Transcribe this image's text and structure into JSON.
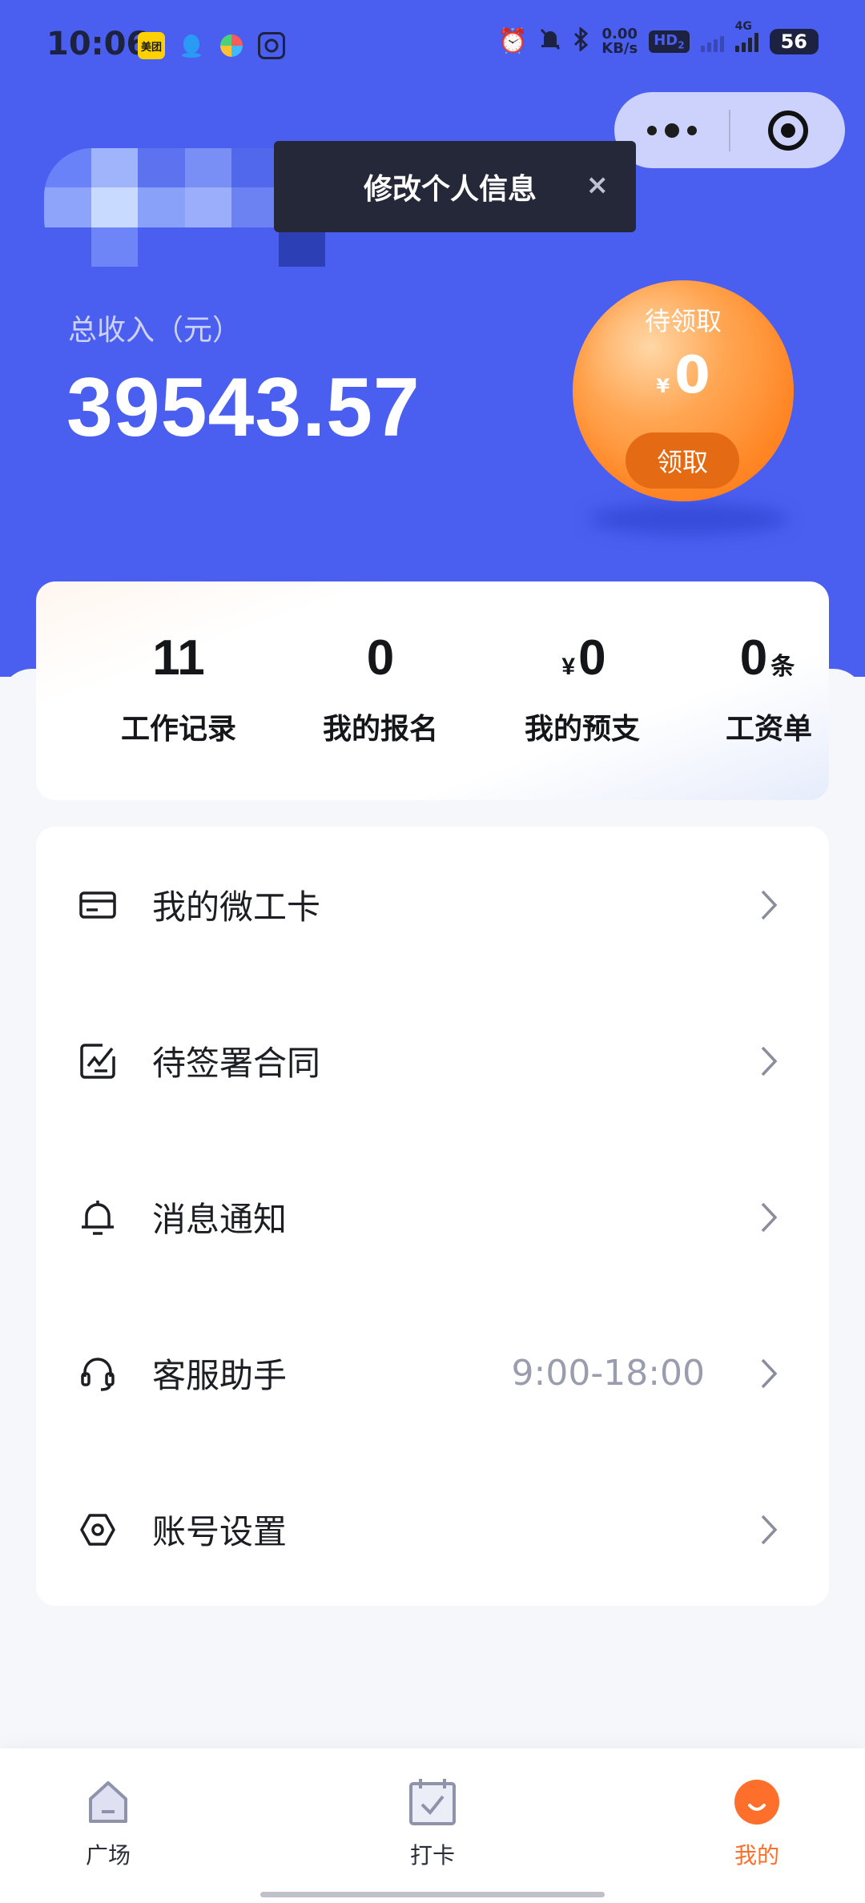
{
  "status_bar": {
    "time": "10:06",
    "app_icons": [
      "meituan-icon",
      "qq-icon",
      "pinwheel-icon",
      "camera-icon"
    ],
    "meituan_label": "美团",
    "speed_value": "0.00",
    "speed_unit": "KB/s",
    "hd_label": "HD",
    "hd_sub": "2",
    "network_label": "4G",
    "battery": "56"
  },
  "tooltip": {
    "text": "修改个人信息",
    "close": "×"
  },
  "income": {
    "label": "总收入（元）",
    "value": "39543.57"
  },
  "bubble": {
    "label": "待领取",
    "currency": "¥",
    "amount": "0",
    "button": "领取"
  },
  "stats": [
    {
      "value": "11",
      "label": "工作记录"
    },
    {
      "value": "0",
      "label": "我的报名"
    },
    {
      "prefix": "¥",
      "value": "0",
      "label": "我的预支"
    },
    {
      "value": "0",
      "suffix": "条",
      "label": "工资单"
    }
  ],
  "menu": [
    {
      "label": "我的微工卡",
      "icon": "card-icon"
    },
    {
      "label": "待签署合同",
      "icon": "contract-icon"
    },
    {
      "label": "消息通知",
      "icon": "bell-icon"
    },
    {
      "label": "客服助手",
      "icon": "headset-icon",
      "extra": "9:00-18:00"
    },
    {
      "label": "账号设置",
      "icon": "settings-hexagon-icon"
    }
  ],
  "tabbar": [
    {
      "label": "广场",
      "icon": "home-icon"
    },
    {
      "label": "打卡",
      "icon": "checkin-calendar-icon"
    },
    {
      "label": "我的",
      "icon": "profile-face-icon",
      "active": true
    }
  ],
  "colors": {
    "header_blue": "#4a5ff0",
    "accent_orange": "#ff6f2c",
    "bubble_button": "#e56a14"
  }
}
